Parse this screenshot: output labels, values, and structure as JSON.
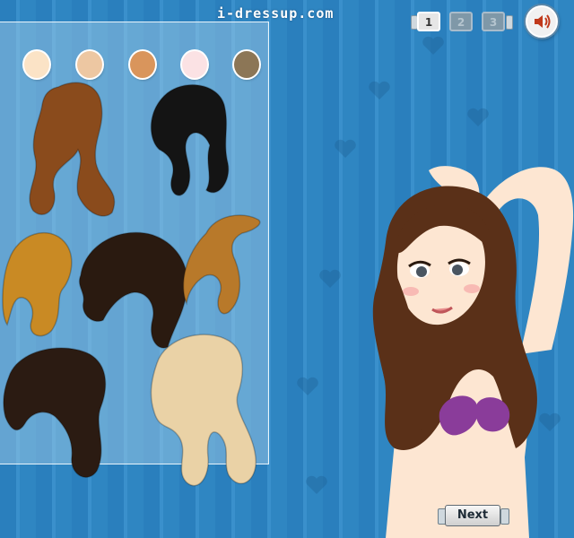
{
  "header": {
    "site_title": "i-dressup.com"
  },
  "pager": {
    "pages": [
      {
        "label": "1",
        "active": true
      },
      {
        "label": "2",
        "active": false
      },
      {
        "label": "3",
        "active": false
      }
    ]
  },
  "controls": {
    "sound_icon": "speaker-icon",
    "next_label": "Next"
  },
  "hair_colors": [
    "#fbe3c6",
    "#edc7a2",
    "#d9955c",
    "#fbe2e4",
    "#8c7656"
  ],
  "hair_options": [
    {
      "id": "long-wavy-auburn",
      "color": "#8a4b1c"
    },
    {
      "id": "long-black",
      "color": "#141414"
    },
    {
      "id": "golden-swept",
      "color": "#c98a24"
    },
    {
      "id": "dark-curly-short",
      "color": "#2a1a10"
    },
    {
      "id": "ponytail-caramel",
      "color": "#b8792a"
    },
    {
      "id": "dark-curly-long",
      "color": "#2b1b12"
    },
    {
      "id": "platinum-wavy",
      "color": "#ead2a6"
    }
  ],
  "model": {
    "hair_color": "#5a3018",
    "skin_color": "#fde6d2",
    "top_color": "#8a3c9a"
  },
  "colors": {
    "background": "#2f86c2",
    "panel_border": "#e8f4fb"
  }
}
